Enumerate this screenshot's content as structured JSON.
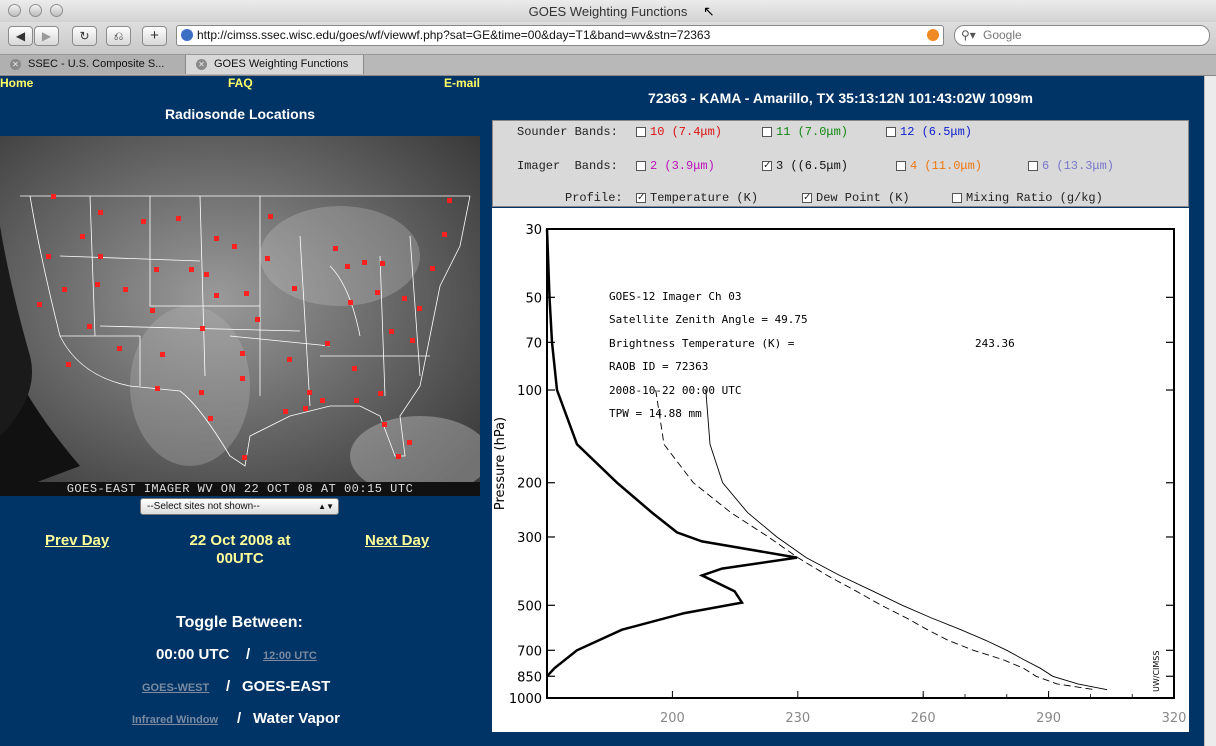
{
  "window": {
    "title": "GOES Weighting Functions"
  },
  "toolbar": {
    "url": "http://cimss.ssec.wisc.edu/goes/wf/viewwf.php?sat=GE&time=00&day=T1&band=wv&stn=72363",
    "search_placeholder": "Google"
  },
  "tabs": [
    {
      "label": "SSEC - U.S. Composite S..."
    },
    {
      "label": "GOES Weighting Functions"
    }
  ],
  "nav": {
    "home": "Home",
    "faq": "FAQ",
    "email": "E-mail"
  },
  "left": {
    "title": "Radiosonde Locations",
    "map_caption": "GOES-EAST IMAGER WV ON 22 OCT 08 AT 00:15 UTC",
    "select_value": "--Select sites not shown--",
    "prev_day": "Prev Day",
    "next_day": "Next Day",
    "date_line1": "22 Oct 2008 at",
    "date_line2": "00UTC",
    "toggle_heading": "Toggle Between:",
    "time_active": "00:00 UTC",
    "time_other": "12:00 UTC",
    "sat_other": "GOES-WEST",
    "sat_active": "GOES-EAST",
    "chan_other": "Infrared Window",
    "chan_active": "Water Vapor",
    "slash": "/"
  },
  "station": {
    "header": "72363 - KAMA - Amarillo, TX 35:13:12N 101:43:02W 1099m"
  },
  "bands": {
    "sounder_label": "Sounder Bands:",
    "imager_label": "Imager  Bands:",
    "profile_label": "Profile:",
    "sounder": [
      {
        "label": "10 (7.4μm)",
        "color": "#dd1111",
        "checked": false
      },
      {
        "label": "11 (7.0μm)",
        "color": "#118811",
        "checked": false
      },
      {
        "label": "12 (6.5μm)",
        "color": "#1122cc",
        "checked": false
      }
    ],
    "imager": [
      {
        "label": "2 (3.9μm)",
        "color": "#bb11bb",
        "checked": false
      },
      {
        "label": "3 ((6.5μm)",
        "color": "#111111",
        "checked": true
      },
      {
        "label": "4 (11.0μm)",
        "color": "#ee7711",
        "checked": false
      },
      {
        "label": "6 (13.3μm)",
        "color": "#7777cc",
        "checked": false
      }
    ],
    "profile": [
      {
        "label": "Temperature (K)",
        "checked": true
      },
      {
        "label": "Dew Point (K)",
        "checked": true
      },
      {
        "label": "Mixing Ratio (g/kg)",
        "checked": false
      }
    ]
  },
  "chart_data": {
    "type": "line",
    "ylabel": "Pressure (hPa)",
    "y_scale": "log",
    "y_reversed": true,
    "ylim": [
      30,
      1000
    ],
    "y_ticks": [
      30,
      50,
      70,
      100,
      200,
      300,
      500,
      700,
      850,
      1000
    ],
    "x_ticks": [
      200,
      230,
      260,
      290,
      320
    ],
    "xlim_temperature": [
      170,
      320
    ],
    "annotations": [
      "GOES-12 Imager  Ch    03",
      "Satellite Zenith Angle = 49.75",
      "Brightness Temperature (K) =",
      "243.36",
      "RAOB ID = 72363",
      "2008-10-22 00:00 UTC",
      "TPW = 14.88 mm",
      "UW/CIMSS"
    ],
    "series": [
      {
        "style": "solid-thick",
        "x_units": "relative weighting",
        "points": [
          [
            0.0,
            30
          ],
          [
            0.01,
            50
          ],
          [
            0.02,
            70
          ],
          [
            0.04,
            100
          ],
          [
            0.12,
            150
          ],
          [
            0.28,
            200
          ],
          [
            0.42,
            250
          ],
          [
            0.52,
            290
          ],
          [
            0.62,
            310
          ],
          [
            1.0,
            350
          ],
          [
            0.7,
            380
          ],
          [
            0.62,
            400
          ],
          [
            0.75,
            450
          ],
          [
            0.78,
            490
          ],
          [
            0.55,
            530
          ],
          [
            0.3,
            600
          ],
          [
            0.12,
            700
          ],
          [
            0.03,
            800
          ],
          [
            0.0,
            850
          ]
        ]
      },
      {
        "name": "Temperature (K)",
        "style": "solid",
        "points": [
          [
            208,
            100
          ],
          [
            209,
            150
          ],
          [
            212,
            200
          ],
          [
            218,
            250
          ],
          [
            225,
            300
          ],
          [
            232,
            350
          ],
          [
            240,
            400
          ],
          [
            248,
            450
          ],
          [
            255,
            500
          ],
          [
            262,
            550
          ],
          [
            269,
            600
          ],
          [
            275,
            650
          ],
          [
            280,
            700
          ],
          [
            284,
            750
          ],
          [
            288,
            800
          ],
          [
            291,
            850
          ],
          [
            297,
            900
          ],
          [
            304,
            940
          ]
        ]
      },
      {
        "name": "Dew Point (K)",
        "style": "dashed",
        "points": [
          [
            196,
            100
          ],
          [
            198,
            150
          ],
          [
            205,
            200
          ],
          [
            214,
            250
          ],
          [
            223,
            300
          ],
          [
            230,
            350
          ],
          [
            237,
            400
          ],
          [
            244,
            450
          ],
          [
            250,
            500
          ],
          [
            256,
            550
          ],
          [
            261,
            600
          ],
          [
            266,
            650
          ],
          [
            272,
            700
          ],
          [
            279,
            750
          ],
          [
            284,
            800
          ],
          [
            287,
            850
          ],
          [
            292,
            900
          ],
          [
            301,
            940
          ]
        ]
      }
    ]
  }
}
